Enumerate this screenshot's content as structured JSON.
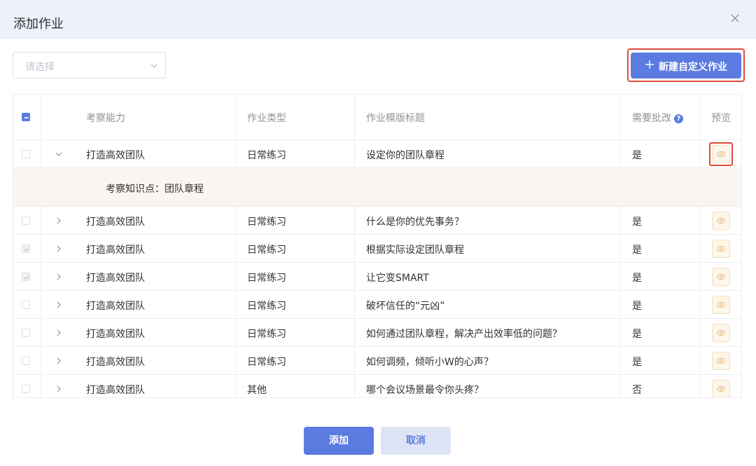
{
  "dialog": {
    "title": "添加作业"
  },
  "toolbar": {
    "select_placeholder": "请选择",
    "new_button_label": "新建自定义作业"
  },
  "table": {
    "headers": {
      "ability": "考察能力",
      "type": "作业类型",
      "template_title": "作业模版标题",
      "need_review": "需要批改",
      "preview": "预览"
    },
    "expanded_row": {
      "knowledge_point": "考察知识点：团队章程"
    },
    "rows": [
      {
        "ability": "打造高效团队",
        "type": "日常练习",
        "title": "设定你的团队章程",
        "review": "是",
        "checked": false,
        "expanded": true
      },
      {
        "ability": "打造高效团队",
        "type": "日常练习",
        "title": "什么是你的优先事务？",
        "review": "是",
        "checked": false,
        "expanded": false
      },
      {
        "ability": "打造高效团队",
        "type": "日常练习",
        "title": "根据实际设定团队章程",
        "review": "是",
        "checked": true,
        "expanded": false
      },
      {
        "ability": "打造高效团队",
        "type": "日常练习",
        "title": "让它变SMART",
        "review": "是",
        "checked": true,
        "expanded": false
      },
      {
        "ability": "打造高效团队",
        "type": "日常练习",
        "title": "破坏信任的“元凶”",
        "review": "是",
        "checked": false,
        "expanded": false
      },
      {
        "ability": "打造高效团队",
        "type": "日常练习",
        "title": "如何通过团队章程，解决产出效率低的问题？",
        "review": "是",
        "checked": false,
        "expanded": false
      },
      {
        "ability": "打造高效团队",
        "type": "日常练习",
        "title": "如何调频，倾听小W的心声？",
        "review": "是",
        "checked": false,
        "expanded": false
      },
      {
        "ability": "打造高效团队",
        "type": "其他",
        "title": "哪个会议场景最令你头疼？",
        "review": "否",
        "checked": false,
        "expanded": false
      }
    ]
  },
  "footer": {
    "add_label": "添加",
    "cancel_label": "取消"
  },
  "colors": {
    "primary": "#5b7be1",
    "highlight_red": "#e04a3a",
    "header_bg": "#eef1fa",
    "expanded_bg": "#faf5f0"
  },
  "icons": {
    "close": "close-icon",
    "select_chevron": "chevron-down-icon",
    "new": "plus-icon",
    "help": "question-circle-icon",
    "preview": "eye-icon",
    "expand": "chevron-right-icon",
    "collapse": "chevron-down-icon"
  }
}
